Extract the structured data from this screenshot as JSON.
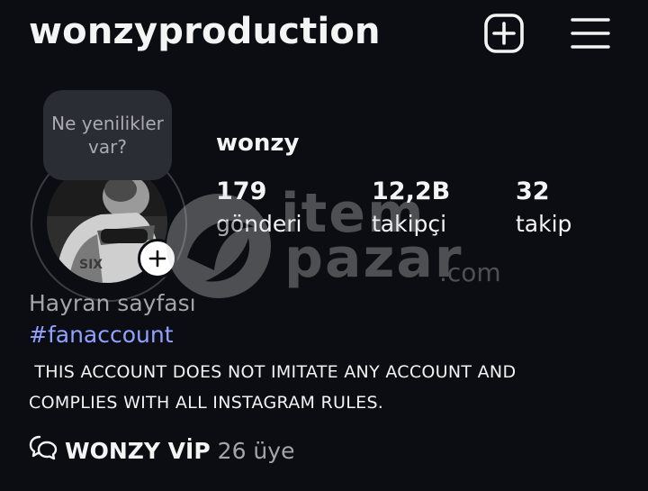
{
  "header": {
    "username": "wonzyproduction",
    "add_icon": "plus-square-icon",
    "menu_icon": "hamburger-menu-icon"
  },
  "note": {
    "text": "Ne yenilikler var?"
  },
  "profile": {
    "display_name": "wonzy",
    "stats": [
      {
        "value": "179",
        "label": "gönderi"
      },
      {
        "value": "12,2B",
        "label": "takipçi"
      },
      {
        "value": "32",
        "label": "takip"
      }
    ]
  },
  "bio": {
    "category": "Hayran sayfası",
    "hashtag": "#fanaccount",
    "text": " THIS ACCOUNT DOES NOT IMITATE ANY ACCOUNT AND\nCOMPLIES WITH ALL INSTAGRAM RULES."
  },
  "channel": {
    "icon": "broadcast-chat-icon",
    "name": "WONZY VİP",
    "members": "26 üye"
  },
  "watermark": {
    "top": "item",
    "bottom": "pazar",
    "suffix": ".com"
  },
  "colors": {
    "background": "#0b0d12",
    "hashtag": "#8fa2ff",
    "secondary_text": "#a3a5ab"
  }
}
